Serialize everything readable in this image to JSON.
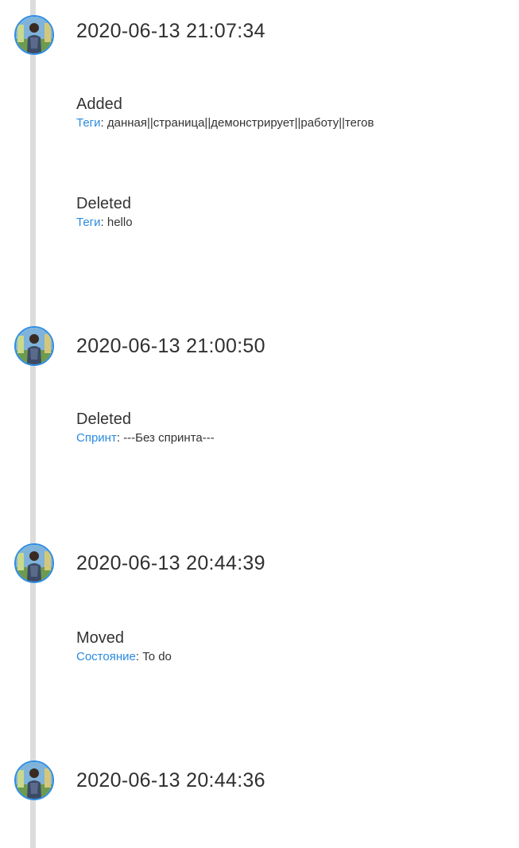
{
  "accent_color": "#2b8be0",
  "timeline": [
    {
      "timestamp": "2020-06-13 21:07:34",
      "changes": [
        {
          "action": "Added",
          "field": "Теги",
          "value": "данная||страница||демонстрирует||работу||тегов"
        },
        {
          "action": "Deleted",
          "field": "Теги",
          "value": "hello"
        }
      ]
    },
    {
      "timestamp": "2020-06-13 21:00:50",
      "changes": [
        {
          "action": "Deleted",
          "field": "Спринт",
          "value": "---Без спринта---"
        }
      ]
    },
    {
      "timestamp": "2020-06-13 20:44:39",
      "changes": [
        {
          "action": "Moved",
          "field": "Состояние",
          "value": "To do"
        }
      ]
    },
    {
      "timestamp": "2020-06-13 20:44:36",
      "changes": []
    }
  ],
  "avatar_icon": "user-avatar-icon",
  "field_separator": ": "
}
